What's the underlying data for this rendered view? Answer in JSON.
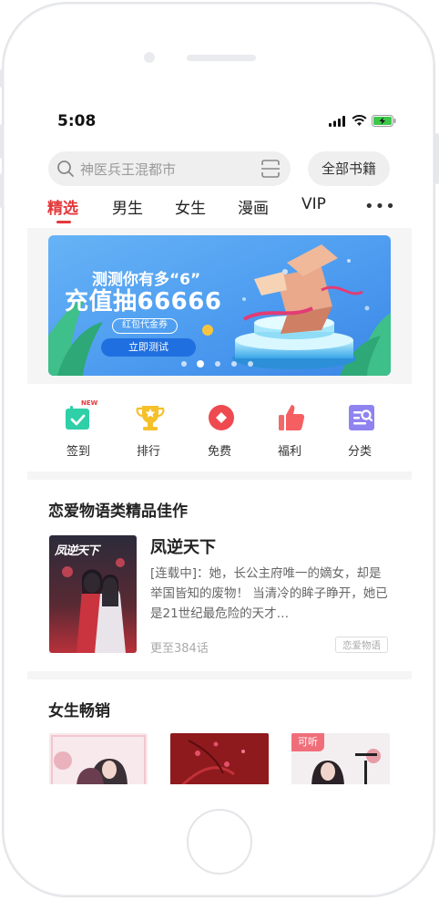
{
  "status": {
    "time": "5:08"
  },
  "search": {
    "placeholder": "神医兵王混都市",
    "all_books": "全部书籍"
  },
  "tabs": [
    {
      "label": "精选",
      "active": true
    },
    {
      "label": "男生"
    },
    {
      "label": "女生"
    },
    {
      "label": "漫画"
    },
    {
      "label": "VIP"
    }
  ],
  "banner": {
    "line1": "测测你有多“6”",
    "line2": "充值抽66666",
    "pill": "红包代金券",
    "button": "立即测试",
    "page_count": 5,
    "active_index": 1
  },
  "quick_links": [
    {
      "label": "签到",
      "icon": "calendar-check-icon",
      "badge": "NEW"
    },
    {
      "label": "排行",
      "icon": "trophy-icon"
    },
    {
      "label": "免费",
      "icon": "free-coin-icon"
    },
    {
      "label": "福利",
      "icon": "thumbs-up-icon"
    },
    {
      "label": "分类",
      "icon": "category-icon"
    }
  ],
  "featured": {
    "section_title": "恋爱物语类精品佳作",
    "book": {
      "title": "凤逆天下",
      "description": "[连载中]：她，长公主府唯一的嫡女，却是举国皆知的废物！ 当清冷的眸子睁开，她已是21世纪最危险的天才…",
      "chapters": "更至384话",
      "tag": "恋爱物语",
      "cover_text": "凤逆天下"
    }
  },
  "female_bestsellers": {
    "section_title": "女生畅销",
    "audio_badge": "可听"
  },
  "colors": {
    "accent": "#e4393c",
    "banner_blue": "#4d9cf0",
    "button_blue": "#1f6fe0"
  }
}
